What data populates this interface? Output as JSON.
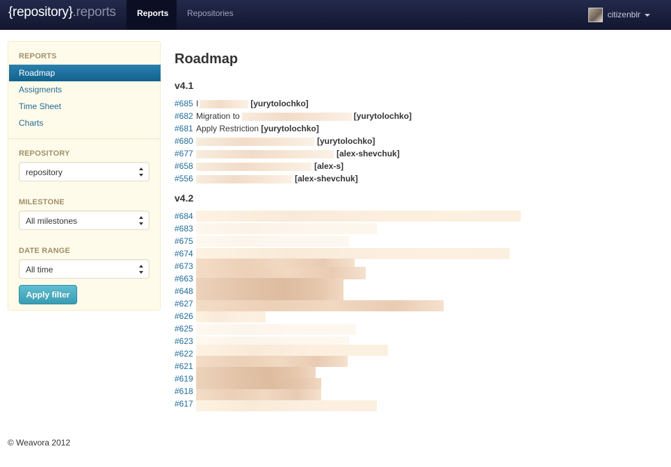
{
  "navbar": {
    "brand_main": "{repository}",
    "brand_suffix": ".reports",
    "items": [
      {
        "label": "Reports",
        "active": true
      },
      {
        "label": "Repositories",
        "active": false
      }
    ],
    "user": "citizenblr"
  },
  "sidebar": {
    "reports_header": "REPORTS",
    "links": [
      "Roadmap",
      "Assigments",
      "Time Sheet",
      "Charts"
    ],
    "active_link": "Roadmap",
    "repository_header": "REPOSITORY",
    "repository_value": "repository",
    "milestone_header": "MILESTONE",
    "milestone_value": "All milestones",
    "date_header": "DATE RANGE",
    "date_value": "All time",
    "apply_label": "Apply filter"
  },
  "main": {
    "title": "Roadmap",
    "milestones": [
      {
        "name": "v4.1",
        "issues": [
          {
            "num": "#685",
            "title": "I",
            "assignee": "[yurytolochko]"
          },
          {
            "num": "#682",
            "title": "Migration to",
            "assignee": "[yurytolochko]"
          },
          {
            "num": "#681",
            "title": "Apply Restriction",
            "assignee": "[yurytolochko]"
          },
          {
            "num": "#680",
            "title": "",
            "assignee": "[yurytolochko]"
          },
          {
            "num": "#677",
            "title": "",
            "assignee": "[alex-shevchuk]"
          },
          {
            "num": "#658",
            "title": "",
            "assignee": "[alex-s]"
          },
          {
            "num": "#556",
            "title": "",
            "assignee": "[alex-shevchuk]"
          }
        ]
      },
      {
        "name": "v4.2",
        "issues": [
          {
            "num": "#684"
          },
          {
            "num": "#683"
          },
          {
            "num": "#675"
          },
          {
            "num": "#674"
          },
          {
            "num": "#673"
          },
          {
            "num": "#663"
          },
          {
            "num": "#648"
          },
          {
            "num": "#627"
          },
          {
            "num": "#626"
          },
          {
            "num": "#625"
          },
          {
            "num": "#623"
          },
          {
            "num": "#622"
          },
          {
            "num": "#621"
          },
          {
            "num": "#619"
          },
          {
            "num": "#618"
          },
          {
            "num": "#617"
          }
        ]
      }
    ]
  },
  "footer": {
    "text": "© Weavora 2012"
  },
  "colors": {
    "navbar": "#1a1f3e",
    "accent": "#1a6f9d",
    "link": "#1f6b9a",
    "sidebar_bg": "#fffbea",
    "button": "#4aafc4"
  }
}
